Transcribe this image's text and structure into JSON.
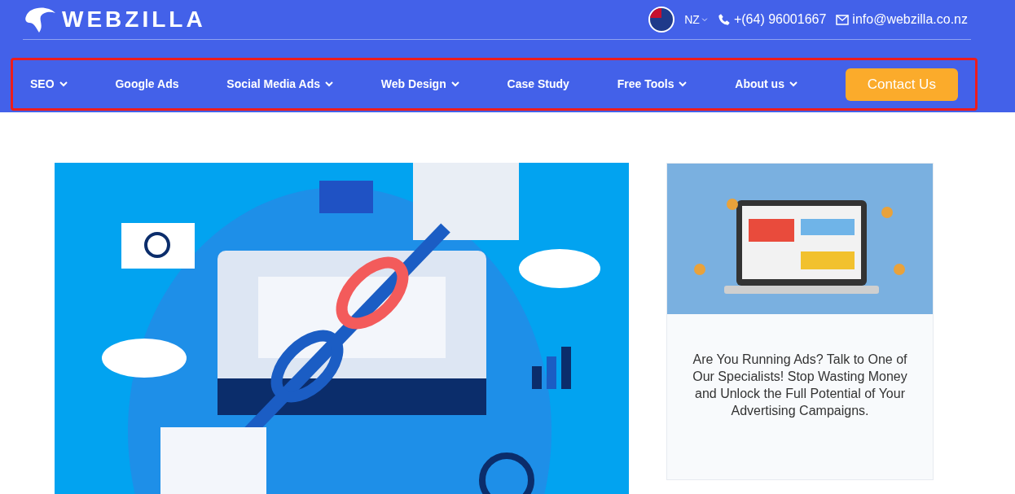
{
  "header": {
    "logo": "WEBZILLA",
    "region": "NZ",
    "phone": "+(64) 96001667",
    "email": "info@webzilla.co.nz"
  },
  "nav": {
    "highlighted": true,
    "items": [
      {
        "label": "SEO",
        "has_menu": true
      },
      {
        "label": "Google Ads",
        "has_menu": false
      },
      {
        "label": "Social Media Ads",
        "has_menu": true
      },
      {
        "label": "Web Design",
        "has_menu": true
      },
      {
        "label": "Case Study",
        "has_menu": false
      },
      {
        "label": "Free Tools",
        "has_menu": true
      },
      {
        "label": "About us",
        "has_menu": true
      }
    ],
    "cta": "Contact Us"
  },
  "promo_card": {
    "text": "Are You Running Ads? Talk to One of Our Specialists! Stop Wasting Money and Unlock the Full Potential of Your Advertising Campaigns."
  }
}
